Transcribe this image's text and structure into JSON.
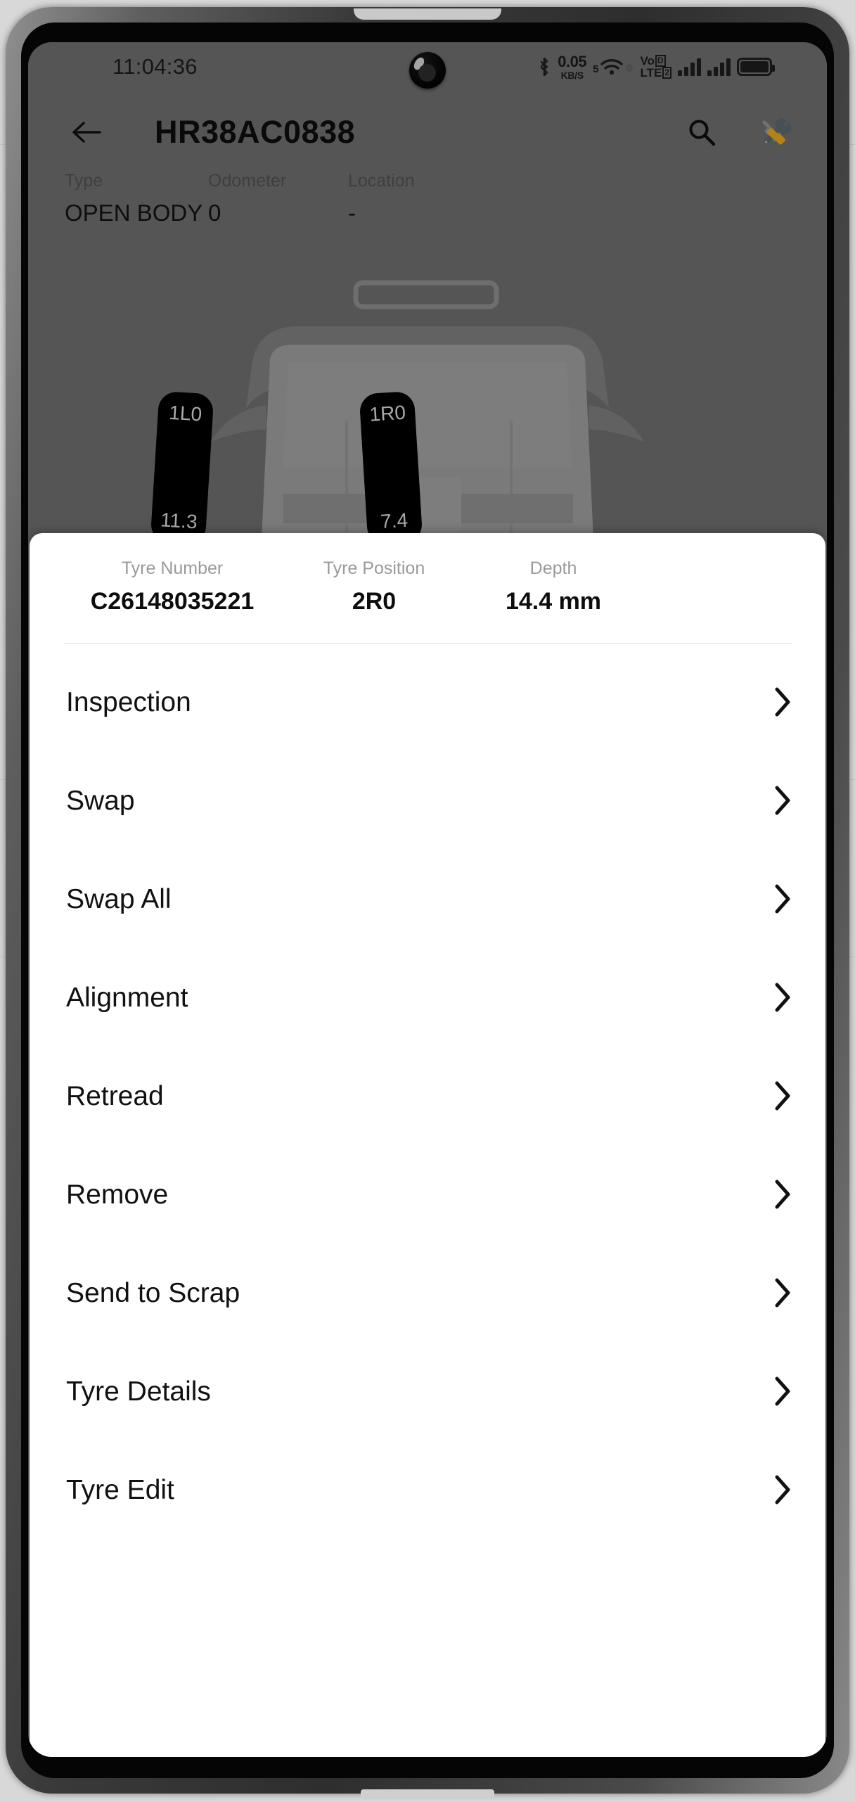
{
  "status_bar": {
    "time": "11:04:36",
    "network_speed_value": "0.05",
    "network_speed_unit": "KB/S",
    "wifi_band": "5",
    "volte_line1": "Vo",
    "volte_badge1": "D",
    "volte_line2": "LTE",
    "volte_badge2": "2",
    "icons": [
      "bluetooth-icon",
      "wifi-icon",
      "volte-icon",
      "signal-bars-icon",
      "signal-bars-2-icon",
      "battery-icon"
    ]
  },
  "appbar": {
    "title": "HR38AC0838",
    "back_icon": "back-arrow-icon",
    "search_icon": "search-icon",
    "tools_icon": "tools-icon"
  },
  "meta": [
    {
      "label": "Type",
      "value": "OPEN BODY"
    },
    {
      "label": "Odometer",
      "value": "0"
    },
    {
      "label": "Location",
      "value": "-"
    }
  ],
  "vehicle_diagram": {
    "tyres": [
      {
        "position": "1L0",
        "depth": "11.3"
      },
      {
        "position": "1R0",
        "depth": "7.4"
      }
    ]
  },
  "sheet": {
    "summary": [
      {
        "label": "Tyre Number",
        "value": "C26148035221"
      },
      {
        "label": "Tyre Position",
        "value": "2R0"
      },
      {
        "label": "Depth",
        "value": "14.4 mm"
      }
    ],
    "menu": [
      {
        "label": "Inspection"
      },
      {
        "label": "Swap"
      },
      {
        "label": "Swap All"
      },
      {
        "label": "Alignment"
      },
      {
        "label": "Retread"
      },
      {
        "label": "Remove"
      },
      {
        "label": "Send to Scrap"
      },
      {
        "label": "Tyre Details"
      },
      {
        "label": "Tyre Edit"
      }
    ]
  },
  "colors": {
    "app_background": "#6d6d6d",
    "sheet_background": "#ffffff",
    "tyre_chip": "#000000",
    "text_primary": "#111111",
    "text_muted": "#9a9a9a"
  }
}
